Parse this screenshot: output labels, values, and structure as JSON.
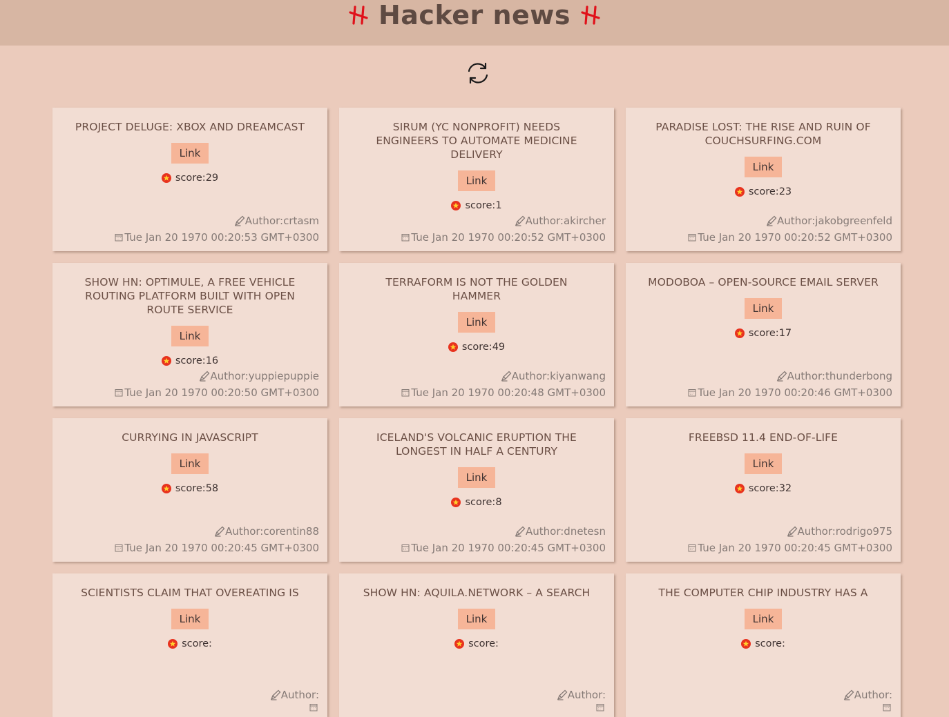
{
  "header": {
    "title": "Hacker news",
    "logo_icon": "hacker-news-h-icon",
    "logo_color": "#e0121b"
  },
  "toolbar": {
    "refresh_icon": "refresh-icon"
  },
  "colors": {
    "background": "#ebcbbc",
    "header": "#d7b6a3",
    "card": "#f2ddd3",
    "button": "#f6b598",
    "star": "#e8321e"
  },
  "labels": {
    "link": "Link",
    "score_prefix": "score: ",
    "author_prefix": "Author: "
  },
  "stories": [
    {
      "title": "Project Deluge: Xbox and Dreamcast",
      "score": "29",
      "author": "crtasm",
      "date": "Tue Jan 20 1970 00:20:53 GMT+0300"
    },
    {
      "title": "Sirum (YC nonprofit) needs engineers to automate medicine delivery",
      "score": "1",
      "author": "akircher",
      "date": "Tue Jan 20 1970 00:20:52 GMT+0300"
    },
    {
      "title": "Paradise Lost: The Rise and Ruin of Couchsurfing.com",
      "score": "23",
      "author": "jakobgreenfeld",
      "date": "Tue Jan 20 1970 00:20:52 GMT+0300"
    },
    {
      "title": "Show HN: Optimule, a free vehicle routing platform built with Open Route Service",
      "score": "16",
      "author": "yuppiepuppie",
      "date": "Tue Jan 20 1970 00:20:50 GMT+0300"
    },
    {
      "title": "Terraform is not the golden hammer",
      "score": "49",
      "author": "kiyanwang",
      "date": "Tue Jan 20 1970 00:20:48 GMT+0300"
    },
    {
      "title": "Modoboa – open-source email server",
      "score": "17",
      "author": "thunderbong",
      "date": "Tue Jan 20 1970 00:20:46 GMT+0300"
    },
    {
      "title": "Currying in JavaScript",
      "score": "58",
      "author": "corentin88",
      "date": "Tue Jan 20 1970 00:20:45 GMT+0300"
    },
    {
      "title": "Iceland's volcanic eruption the longest in half a century",
      "score": "8",
      "author": "dnetesn",
      "date": "Tue Jan 20 1970 00:20:45 GMT+0300"
    },
    {
      "title": "FreeBSD 11.4 end-of-life",
      "score": "32",
      "author": "rodrigo975",
      "date": "Tue Jan 20 1970 00:20:45 GMT+0300"
    },
    {
      "title": "Scientists claim that overeating is",
      "score": "",
      "author": "",
      "date": ""
    },
    {
      "title": "Show HN: Aquila.network – A search",
      "score": "",
      "author": "",
      "date": ""
    },
    {
      "title": "The computer chip industry has a",
      "score": "",
      "author": "",
      "date": ""
    }
  ]
}
